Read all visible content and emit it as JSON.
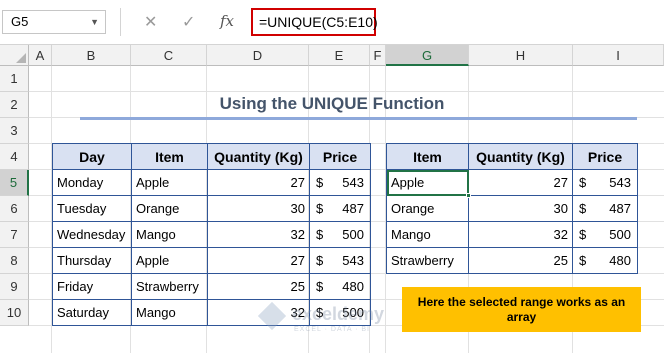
{
  "formula_bar": {
    "name_box": "G5",
    "cancel_glyph": "✕",
    "enter_glyph": "✓",
    "fx_glyph": "fx",
    "formula": "=UNIQUE(C5:E10)"
  },
  "columns": [
    "A",
    "B",
    "C",
    "D",
    "E",
    "F",
    "G",
    "H",
    "I"
  ],
  "selected_column": "G",
  "rows": [
    "1",
    "2",
    "3",
    "4",
    "5",
    "6",
    "7",
    "8",
    "9",
    "10"
  ],
  "selected_row": "5",
  "title": "Using the UNIQUE Function",
  "source_table": {
    "headers": [
      "Day",
      "Item",
      "Quantity (Kg)",
      "Price"
    ],
    "currency": "$",
    "rows": [
      {
        "day": "Monday",
        "item": "Apple",
        "qty": "27",
        "price": "543"
      },
      {
        "day": "Tuesday",
        "item": "Orange",
        "qty": "30",
        "price": "487"
      },
      {
        "day": "Wednesday",
        "item": "Mango",
        "qty": "32",
        "price": "500"
      },
      {
        "day": "Thursday",
        "item": "Apple",
        "qty": "27",
        "price": "543"
      },
      {
        "day": "Friday",
        "item": "Strawberry",
        "qty": "25",
        "price": "480"
      },
      {
        "day": "Saturday",
        "item": "Mango",
        "qty": "32",
        "price": "500"
      }
    ]
  },
  "result_table": {
    "headers": [
      "Item",
      "Quantity (Kg)",
      "Price"
    ],
    "currency": "$",
    "rows": [
      {
        "item": "Apple",
        "qty": "27",
        "price": "543"
      },
      {
        "item": "Orange",
        "qty": "30",
        "price": "487"
      },
      {
        "item": "Mango",
        "qty": "32",
        "price": "500"
      },
      {
        "item": "Strawberry",
        "qty": "25",
        "price": "480"
      }
    ]
  },
  "note": "Here the selected range works as an array",
  "watermark": {
    "name": "exceldemy",
    "tagline": "EXCEL · DATA · BI"
  },
  "colors": {
    "accent_green": "#217346",
    "table_border": "#2f5597",
    "header_fill": "#d9e1f2",
    "note_fill": "#ffc000",
    "formula_highlight": "#d00000"
  }
}
